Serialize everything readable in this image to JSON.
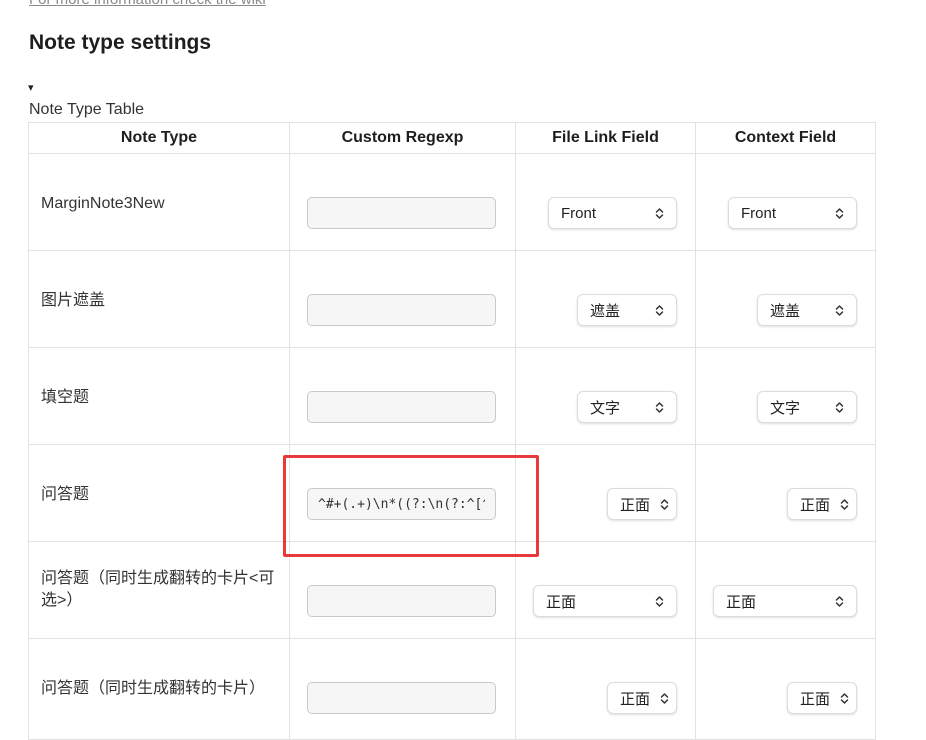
{
  "wiki_link": "For more information check the wiki",
  "heading": "Note type settings",
  "details_toggle": "▾",
  "table_caption": "Note Type Table",
  "columns": {
    "note_type": "Note Type",
    "custom_regexp": "Custom Regexp",
    "file_link_field": "File Link Field",
    "context_field": "Context Field"
  },
  "rows": [
    {
      "note_type": "MarginNote3New",
      "regexp": "",
      "file_link": "Front",
      "context": "Front"
    },
    {
      "note_type": "图片遮盖",
      "regexp": "",
      "file_link": "遮盖",
      "context": "遮盖"
    },
    {
      "note_type": "填空题",
      "regexp": "",
      "file_link": "文字",
      "context": "文字"
    },
    {
      "note_type": "问答题",
      "regexp": "^#+(.+)\\n*((?:\\n(?:^[^\\n#]",
      "file_link": "正面",
      "context": "正面"
    },
    {
      "note_type": "问答题（同时生成翻转的卡片<可选>）",
      "regexp": "",
      "file_link": "正面",
      "context": "正面"
    },
    {
      "note_type": "问答题（同时生成翻转的卡片）",
      "regexp": "",
      "file_link": "正面",
      "context": "正面"
    }
  ],
  "colors": {
    "highlight": "#e83a3a",
    "border": "#e2e2e2",
    "input_bg": "#f6f6f6"
  },
  "icons": {
    "select_arrow": "chevron-up-down-icon"
  }
}
